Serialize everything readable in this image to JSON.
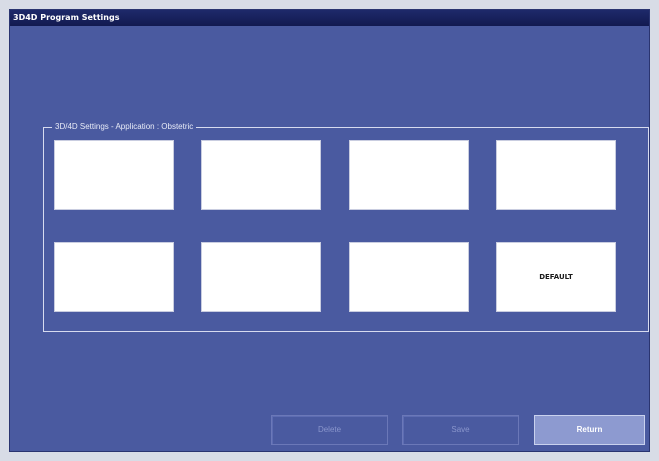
{
  "window": {
    "title": "3D4D Program Settings"
  },
  "settings_group": {
    "label": "3D/4D Settings - Application : Obstetric"
  },
  "slots": [
    {
      "label": ""
    },
    {
      "label": ""
    },
    {
      "label": ""
    },
    {
      "label": ""
    },
    {
      "label": ""
    },
    {
      "label": ""
    },
    {
      "label": ""
    },
    {
      "label": "DEFAULT"
    }
  ],
  "buttons": {
    "delete_label": "Delete",
    "save_label": "Save",
    "return_label": "Return"
  },
  "colors": {
    "window_background": "#4a5aa0",
    "title_bar": "#1e2a6a",
    "slot_background": "#ffffff",
    "return_button": "#8d9ad0"
  }
}
